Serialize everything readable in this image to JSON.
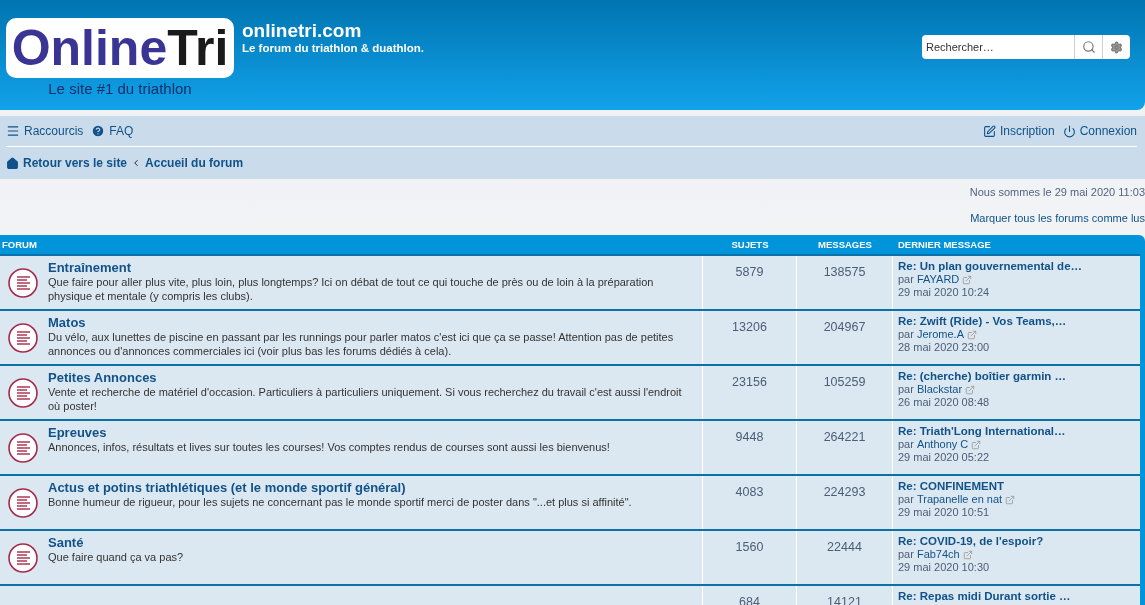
{
  "header": {
    "logo": {
      "main": "Online",
      "accent": "Tri",
      "tagline": "Le site #1 du triathlon"
    },
    "site_title": "onlinetri.com",
    "site_description": "Le forum du triathlon & duathlon.",
    "search": {
      "placeholder": "Rechercher…"
    }
  },
  "navbar": {
    "left": [
      {
        "kind": "menu",
        "label": "Raccourcis"
      },
      {
        "kind": "help",
        "label": "FAQ"
      }
    ],
    "right": [
      {
        "kind": "register",
        "label": "Inscription"
      },
      {
        "kind": "login",
        "label": "Connexion"
      }
    ]
  },
  "breadcrumbs": [
    {
      "kind": "home",
      "label": "Retour vers le site"
    },
    {
      "kind": "crumb",
      "label": "Accueil du forum"
    }
  ],
  "current_time": "Nous sommes le 29 mai 2020 11:03",
  "mark_read": "Marquer tous les forums comme lus",
  "table": {
    "columns": [
      "FORUM",
      "SUJETS",
      "MESSAGES",
      "DERNIER MESSAGE"
    ],
    "rows": [
      {
        "title": "Entraînement",
        "description": "Que faire pour aller plus vite, plus loin, plus longtemps? Ici on débat de tout ce qui touche de près ou de loin à la préparation physique et mentale (y compris les clubs).",
        "topics": "5879",
        "posts": "138575",
        "last_post": {
          "title": "Re: Un plan gouvernemental de…",
          "by": "par",
          "author": "FAYARD",
          "date": "29 mai 2020 10:24"
        }
      },
      {
        "title": "Matos",
        "description": "Du vélo, aux lunettes de piscine en passant par les runnings pour parler matos c'est ici que ça se passe! Attention pas de petites annonces ou d'annonces commerciales ici (voir plus bas les forums dédiés à cela).",
        "topics": "13206",
        "posts": "204967",
        "last_post": {
          "title": "Re: Zwift (Ride) - Vos Teams,…",
          "by": "par",
          "author": "Jerome.A",
          "date": "28 mai 2020 23:00"
        }
      },
      {
        "title": "Petites Annonces",
        "description": "Vente et recherche de matériel d'occasion. Particuliers à particuliers uniquement. Si vous recherchez du travail c'est aussi l'endroit où poster!",
        "topics": "23156",
        "posts": "105259",
        "last_post": {
          "title": "Re: (cherche) boîtier garmin …",
          "by": "par",
          "author": "Blackstar",
          "date": "26 mai 2020 08:48"
        }
      },
      {
        "title": "Epreuves",
        "description": "Annonces, infos, résultats et lives sur toutes les courses! Vos comptes rendus de courses sont aussi les bienvenus!",
        "topics": "9448",
        "posts": "264221",
        "last_post": {
          "title": "Re: Triath'Long International…",
          "by": "par",
          "author": "Anthony C",
          "date": "29 mai 2020 05:22"
        }
      },
      {
        "title": "Actus et potins triathlétiques (et le monde sportif général)",
        "description": "Bonne humeur de rigueur, pour les sujets ne concernant pas le monde sportif merci de poster dans \"...et plus si affinité\".",
        "topics": "4083",
        "posts": "224293",
        "last_post": {
          "title": "Re: CONFINEMENT",
          "by": "par",
          "author": "Trapanelle en nat",
          "date": "29 mai 2020 10:51"
        }
      },
      {
        "title": "Santé",
        "description": "Que faire quand ça va pas?",
        "topics": "1560",
        "posts": "22444",
        "last_post": {
          "title": "Re: COVID-19, de l'espoir?",
          "by": "par",
          "author": "Fab74ch",
          "date": "29 mai 2020 10:30"
        }
      },
      {
        "topics": "684",
        "posts": "14121",
        "last_post": {
          "title": "Re: Repas midi Durant sortie …"
        }
      }
    ]
  }
}
